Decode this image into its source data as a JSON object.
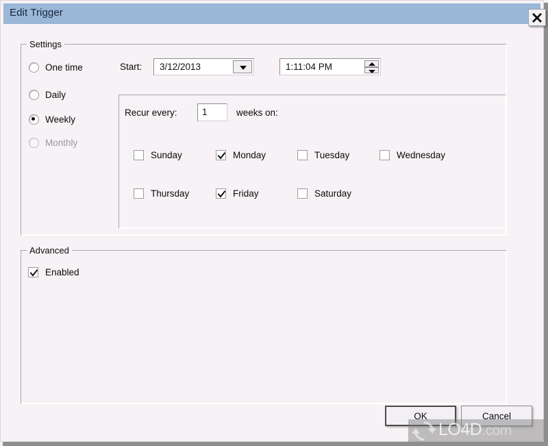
{
  "window": {
    "title": "Edit Trigger",
    "close_icon": "close-icon",
    "titlebar_color": "#9bb7d7",
    "background_color": "#f6f2f5"
  },
  "settings_group": {
    "legend": "Settings",
    "schedule_options": [
      {
        "label": "One time",
        "selected": false,
        "disabled": false
      },
      {
        "label": "Daily",
        "selected": false,
        "disabled": false
      },
      {
        "label": "Weekly",
        "selected": true,
        "disabled": false
      },
      {
        "label": "Monthly",
        "selected": false,
        "disabled": true
      }
    ],
    "start": {
      "label": "Start:",
      "date_value": "3/12/2013",
      "date_dropdown_icon": "chevron-down-icon",
      "time_value": "1:11:04 PM",
      "time_spinner_up_icon": "spinner-up-icon",
      "time_spinner_down_icon": "spinner-down-icon"
    },
    "recurrence": {
      "prefix_label": "Recur every:",
      "interval_value": "1",
      "suffix_label": "weeks on:",
      "days": [
        {
          "label": "Sunday",
          "checked": false
        },
        {
          "label": "Monday",
          "checked": true
        },
        {
          "label": "Tuesday",
          "checked": false
        },
        {
          "label": "Wednesday",
          "checked": false
        },
        {
          "label": "Thursday",
          "checked": false
        },
        {
          "label": "Friday",
          "checked": true
        },
        {
          "label": "Saturday",
          "checked": false
        }
      ]
    }
  },
  "advanced_group": {
    "legend": "Advanced",
    "enabled": {
      "label": "Enabled",
      "checked": true
    }
  },
  "footer": {
    "ok_label": "OK",
    "cancel_label": "Cancel"
  },
  "watermark": {
    "text_main": "LO4D",
    "text_suffix": ".com",
    "logo_icon": "refresh-circular-arrows-icon"
  }
}
